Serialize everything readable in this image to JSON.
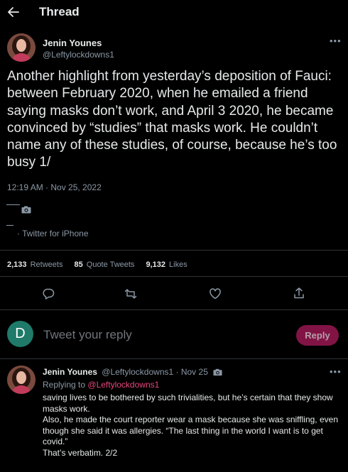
{
  "header": {
    "back_icon": "arrow-left-icon",
    "title": "Thread"
  },
  "main_tweet": {
    "author_name": "Jenin Younes",
    "author_handle": "@Leftylockdowns1",
    "more_icon": "more-horizontal-icon",
    "text": "Another highlight from yesterday’s deposition of Fauci: between February 2020, when he emailed a friend saying masks don’t work, and April 3 2020, he became convinced by “studies” that masks work. He couldn’t name any of these studies, of course, because he’s too busy 1/",
    "timestamp": "12:19 AM · Nov 25, 2022",
    "source": "· Twitter for iPhone",
    "stats": {
      "retweets_count": "2,133",
      "retweets_label": "Retweets",
      "quote_count": "85",
      "quote_label": "Quote Tweets",
      "likes_count": "9,132",
      "likes_label": "Likes"
    },
    "actions": [
      "reply-icon",
      "retweet-icon",
      "like-icon",
      "share-icon"
    ]
  },
  "compose": {
    "avatar_letter": "D",
    "placeholder": "Tweet your reply",
    "reply_button": "Reply"
  },
  "reply_tweet": {
    "author_name": "Jenin Younes",
    "author_handle": "@Leftylockdowns1",
    "date": "· Nov 25",
    "replying_prefix": "Replying to",
    "replying_mention": "@Leftylockdowns1",
    "lines": [
      "saving lives to be bothered by such trivialities, but he’s certain that they show masks work.",
      "Also, he made the court reporter wear a mask because she was sniffling, even though she said it was allergies. “The last thing in the world I want is to get covid.”",
      "That’s verbatim. 2/2"
    ]
  },
  "colors": {
    "background": "#000000",
    "text_primary": "#e7e9ea",
    "text_secondary": "#8b98a5",
    "accent": "#e8467a",
    "reply_button_bg": "#821445",
    "divider": "#2f3336"
  }
}
